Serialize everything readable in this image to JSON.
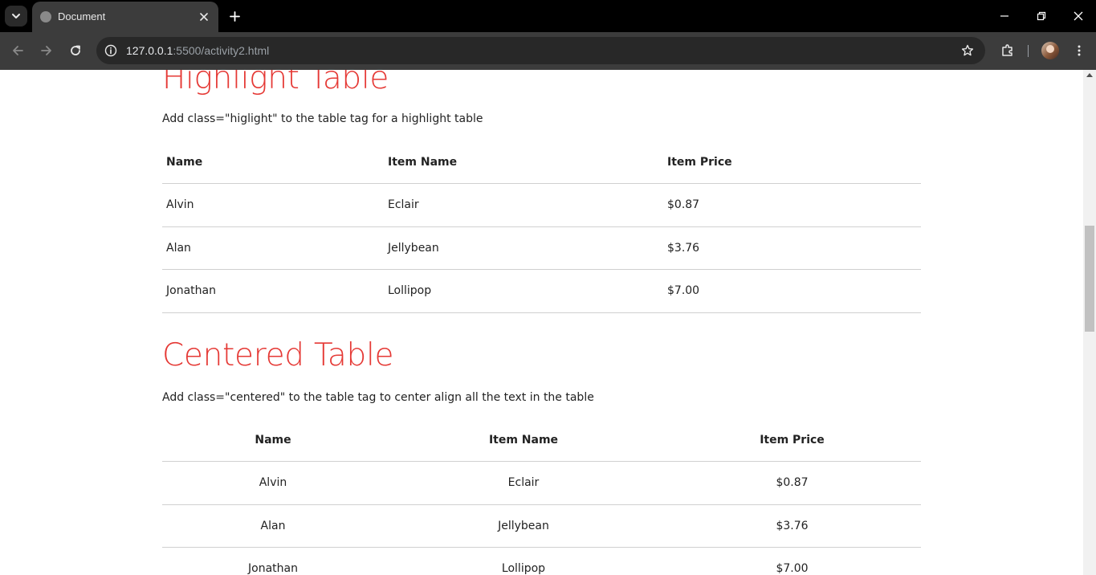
{
  "browser": {
    "tab_title": "Document",
    "url_host": "127.0.0.1",
    "url_rest": ":5500/activity2.html"
  },
  "page": {
    "highlight": {
      "title": "Highlight Table",
      "description": "Add class=\"higlight\" to the table tag for a highlight table",
      "headers": [
        "Name",
        "Item Name",
        "Item Price"
      ],
      "rows": [
        [
          "Alvin",
          "Eclair",
          "$0.87"
        ],
        [
          "Alan",
          "Jellybean",
          "$3.76"
        ],
        [
          "Jonathan",
          "Lollipop",
          "$7.00"
        ]
      ]
    },
    "centered": {
      "title": "Centered Table",
      "description": "Add class=\"centered\" to the table tag to center align all the text in the table",
      "headers": [
        "Name",
        "Item Name",
        "Item Price"
      ],
      "rows": [
        [
          "Alvin",
          "Eclair",
          "$0.87"
        ],
        [
          "Alan",
          "Jellybean",
          "$3.76"
        ],
        [
          "Jonathan",
          "Lollipop",
          "$7.00"
        ]
      ]
    }
  },
  "colors": {
    "heading": "#e53935",
    "chrome_dark": "#000000",
    "chrome_toolbar": "#3c3c3c"
  }
}
